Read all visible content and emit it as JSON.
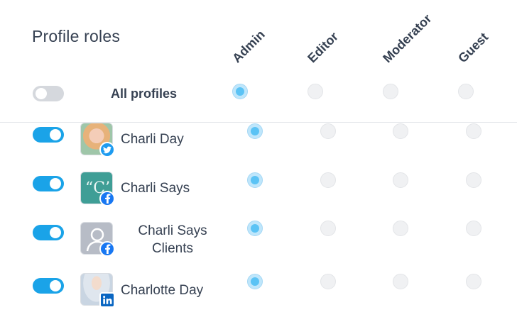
{
  "title": "Profile roles",
  "roles": [
    "Admin",
    "Editor",
    "Moderator",
    "Guest"
  ],
  "all_profiles": {
    "label": "All profiles",
    "enabled": false,
    "selected_role": "Admin"
  },
  "profiles": [
    {
      "name": "Charli Day",
      "network": "twitter",
      "enabled": true,
      "role": "Admin"
    },
    {
      "name": "Charli Says",
      "network": "facebook",
      "enabled": true,
      "role": "Admin"
    },
    {
      "name_line1": "Charli Says",
      "name_line2": "Clients",
      "network": "facebook",
      "enabled": true,
      "role": "Admin"
    },
    {
      "name": "Charlotte Day",
      "network": "linkedin",
      "enabled": true,
      "role": "Admin"
    }
  ],
  "colors": {
    "accent": "#1aa3e8",
    "radio_selected": "#5bc3f5",
    "text": "#364152"
  }
}
